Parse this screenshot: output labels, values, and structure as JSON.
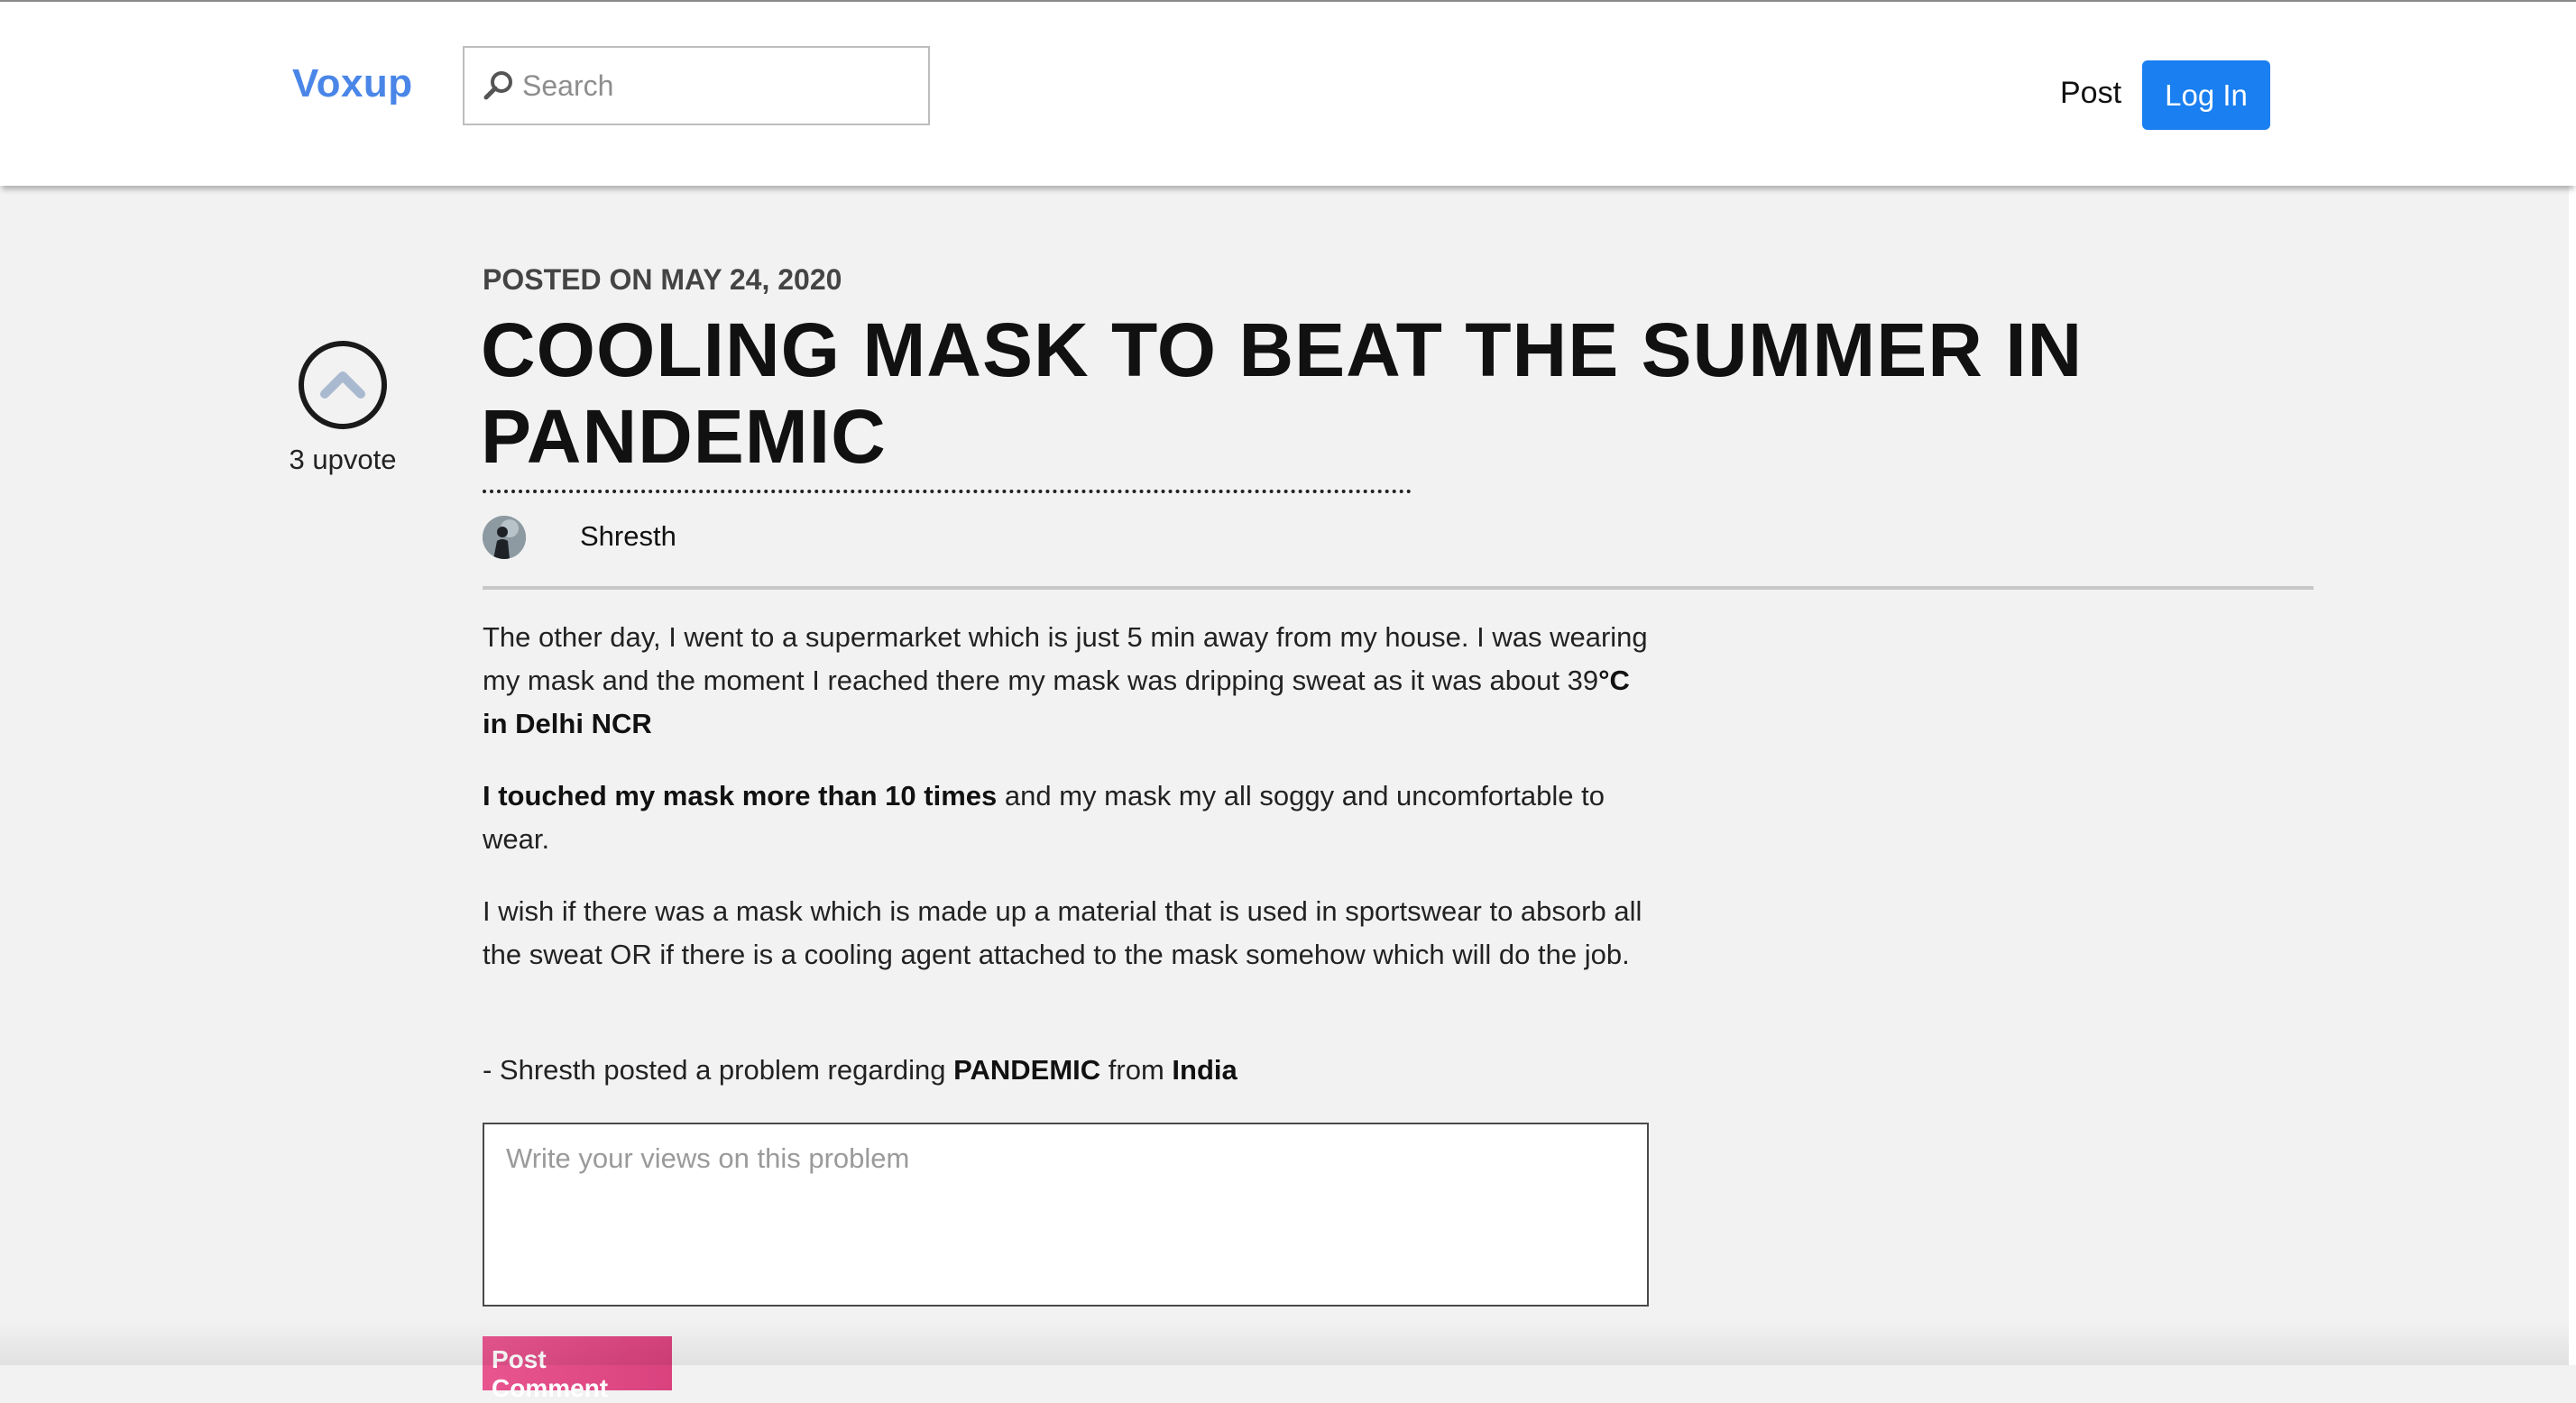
{
  "header": {
    "logo": "Voxup",
    "search_placeholder": "Search",
    "post_link": "Post",
    "login_button": "Log In"
  },
  "upvote": {
    "count_label": "3 upvote"
  },
  "post": {
    "posted_on": "POSTED ON MAY 24, 2020",
    "title": "COOLING MASK TO BEAT THE SUMMER IN PANDEMIC",
    "author": "Shresth",
    "paragraph1": {
      "text": "The other day, I went to a supermarket which is just 5 min away from my house. I was wearing my mask and the moment I reached there my mask was dripping sweat as it was about 39",
      "bold": "°C in Delhi NCR"
    },
    "paragraph2": {
      "bold": "I touched my mask more than 10 times",
      "text": " and my mask my all soggy and uncomfortable to wear."
    },
    "paragraph3": {
      "text": "I wish if there was a mask which is made up a material that is used in sportswear to absorb all the sweat OR if there is a cooling agent attached to the mask somehow which will do the job."
    },
    "attribution": {
      "prefix": "- Shresth posted a problem regarding ",
      "category": "PANDEMIC",
      "middle": " from ",
      "country": "India"
    }
  },
  "comment": {
    "placeholder": "Write your views on this problem",
    "button": "Post Comment"
  },
  "colors": {
    "brand": "#4a86e8",
    "login_button": "#1a7ff0",
    "post_comment_button": "#e0497f",
    "background": "#f2f2f2"
  }
}
